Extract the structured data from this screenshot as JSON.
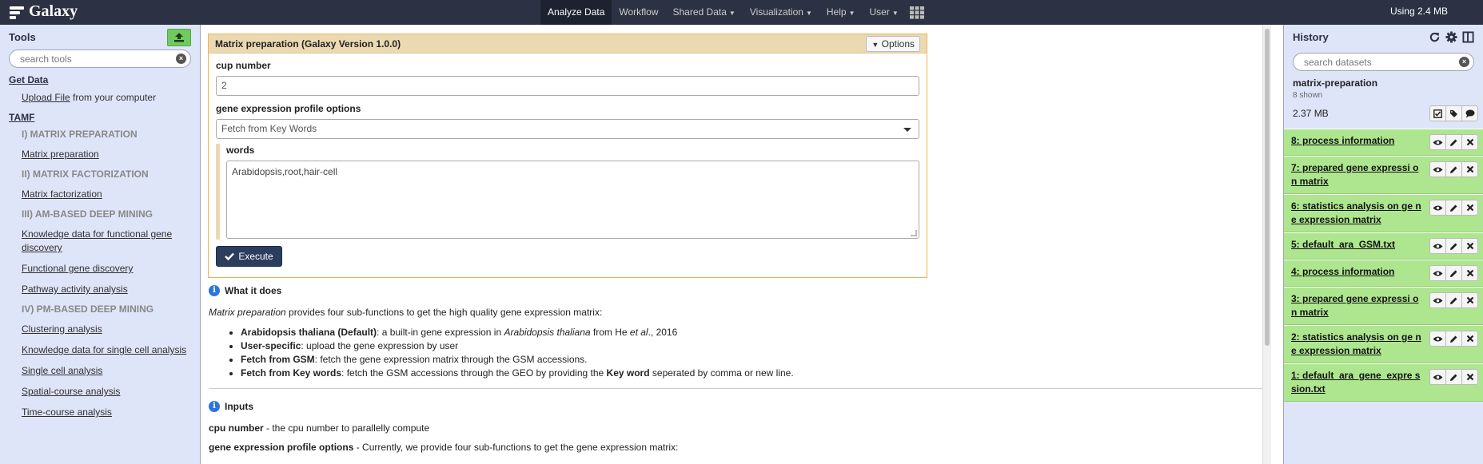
{
  "brand": {
    "title": "Galaxy"
  },
  "nav": {
    "items": [
      {
        "label": "Analyze Data",
        "dropdown": false,
        "active": true
      },
      {
        "label": "Workflow",
        "dropdown": false,
        "active": false
      },
      {
        "label": "Shared Data",
        "dropdown": true,
        "active": false
      },
      {
        "label": "Visualization",
        "dropdown": true,
        "active": false
      },
      {
        "label": "Help",
        "dropdown": true,
        "active": false
      },
      {
        "label": "User",
        "dropdown": true,
        "active": false
      }
    ],
    "quota": "Using 2.4 MB"
  },
  "tools": {
    "title": "Tools",
    "search_placeholder": "search tools",
    "get_data_section": "Get Data",
    "upload_link": "Upload File",
    "upload_suffix": " from your computer",
    "tamf_section": "TAMF",
    "items": [
      {
        "kind": "label",
        "text": "I) MATRIX PREPARATION"
      },
      {
        "kind": "link",
        "text": "Matrix preparation"
      },
      {
        "kind": "label",
        "text": "II) MATRIX FACTORIZATION"
      },
      {
        "kind": "link",
        "text": "Matrix factorization"
      },
      {
        "kind": "label",
        "text": "III) AM-BASED DEEP MINING"
      },
      {
        "kind": "link",
        "text": "Knowledge data for functional gene discovery"
      },
      {
        "kind": "link",
        "text": "Functional gene discovery"
      },
      {
        "kind": "link",
        "text": "Pathway activity analysis"
      },
      {
        "kind": "label",
        "text": "IV) PM-BASED DEEP MINING"
      },
      {
        "kind": "link",
        "text": "Clustering analysis"
      },
      {
        "kind": "link",
        "text": "Knowledge data for single cell analysis"
      },
      {
        "kind": "link",
        "text": "Single cell analysis"
      },
      {
        "kind": "link",
        "text": "Spatial-course analysis"
      },
      {
        "kind": "link",
        "text": "Time-course analysis"
      }
    ]
  },
  "form": {
    "title": "Matrix preparation (Galaxy Version 1.0.0)",
    "options_label": "Options",
    "cup_label": "cup number",
    "cup_value": "2",
    "profile_label": "gene expression profile options",
    "profile_value": "Fetch from Key Words",
    "words_label": "words",
    "words_value": "Arabidopsis,root,hair-cell",
    "execute_label": "Execute"
  },
  "help": {
    "what_title": "What it does",
    "intro_em": "Matrix preparation",
    "intro_rest": " provides four sub-functions to get the high quality gene expression matrix:",
    "bullets": [
      {
        "b": "Arabidopsis thaliana (Default)",
        "t1": ": a built-in gene expression in ",
        "em": "Arabidopsis thaliana",
        "t2": " from He ",
        "em2": "et al",
        "t3": "., 2016"
      },
      {
        "b": "User-specific",
        "t1": ": upload the gene expression by user"
      },
      {
        "b": "Fetch from GSM",
        "t1": ": fetch the gene expression matrix through the GSM accessions."
      },
      {
        "b": "Fetch from Key words",
        "t1": ": fetch the GSM accessions through the GEO by providing the ",
        "b2": "Key word",
        "t2": " seperated by comma or new line."
      }
    ],
    "inputs_title": "Inputs",
    "input1_b": "cpu number",
    "input1_t": " - the cpu number to parallelly compute",
    "input2_b": "gene expression profile options",
    "input2_t": " - Currently, we provide four sub-functions to get the gene expression matrix:"
  },
  "history": {
    "title": "History",
    "search_placeholder": "search datasets",
    "name": "matrix-preparation",
    "count": "8 shown",
    "size": "2.37 MB",
    "datasets": [
      {
        "title": "8: process information"
      },
      {
        "title": "7: prepared gene expressi on matrix"
      },
      {
        "title": "6: statistics analysis on ge ne expression matrix"
      },
      {
        "title": "5: default_ara_GSM.txt"
      },
      {
        "title": "4: process information"
      },
      {
        "title": "3: prepared gene expressi on matrix"
      },
      {
        "title": "2: statistics analysis on ge ne expression matrix"
      },
      {
        "title": "1: default_ara_gene_expre ssion.txt"
      }
    ]
  },
  "colors": {
    "masthead": "#2c3143",
    "panel": "#dfe5f9",
    "dataset_ok": "#aee68f",
    "form_border": "#f0b252",
    "execute": "#2c3e5e"
  }
}
